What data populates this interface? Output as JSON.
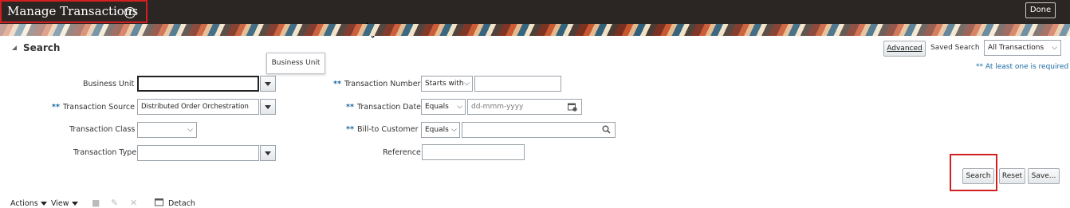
{
  "header": {
    "title": "Manage Transactions",
    "help_icon": "help-circle-icon",
    "done_label": "Done"
  },
  "search": {
    "heading": "Search",
    "advanced_label": "Advanced",
    "saved_search_label": "Saved Search",
    "saved_search_value": "All Transactions",
    "required_hint": "** At least one is required",
    "tooltip": "Business Unit",
    "required_marker": "**",
    "fields": {
      "business_unit": {
        "label": "Business Unit",
        "value": ""
      },
      "transaction_source": {
        "label": "Transaction Source",
        "value": "Distributed Order Orchestration"
      },
      "transaction_class": {
        "label": "Transaction Class",
        "value": ""
      },
      "transaction_type": {
        "label": "Transaction Type",
        "value": ""
      },
      "transaction_number": {
        "label": "Transaction Number",
        "operator": "Starts with",
        "value": ""
      },
      "transaction_date": {
        "label": "Transaction Date",
        "operator": "Equals",
        "placeholder": "dd-mmm-yyyy"
      },
      "bill_to_customer": {
        "label": "Bill-to Customer",
        "operator": "Equals",
        "value": ""
      },
      "reference": {
        "label": "Reference",
        "value": ""
      }
    },
    "search_label": "Search",
    "reset_label": "Reset",
    "save_label": "Save..."
  },
  "toolbar": {
    "actions_label": "Actions",
    "view_label": "View",
    "detach_label": "Detach"
  }
}
